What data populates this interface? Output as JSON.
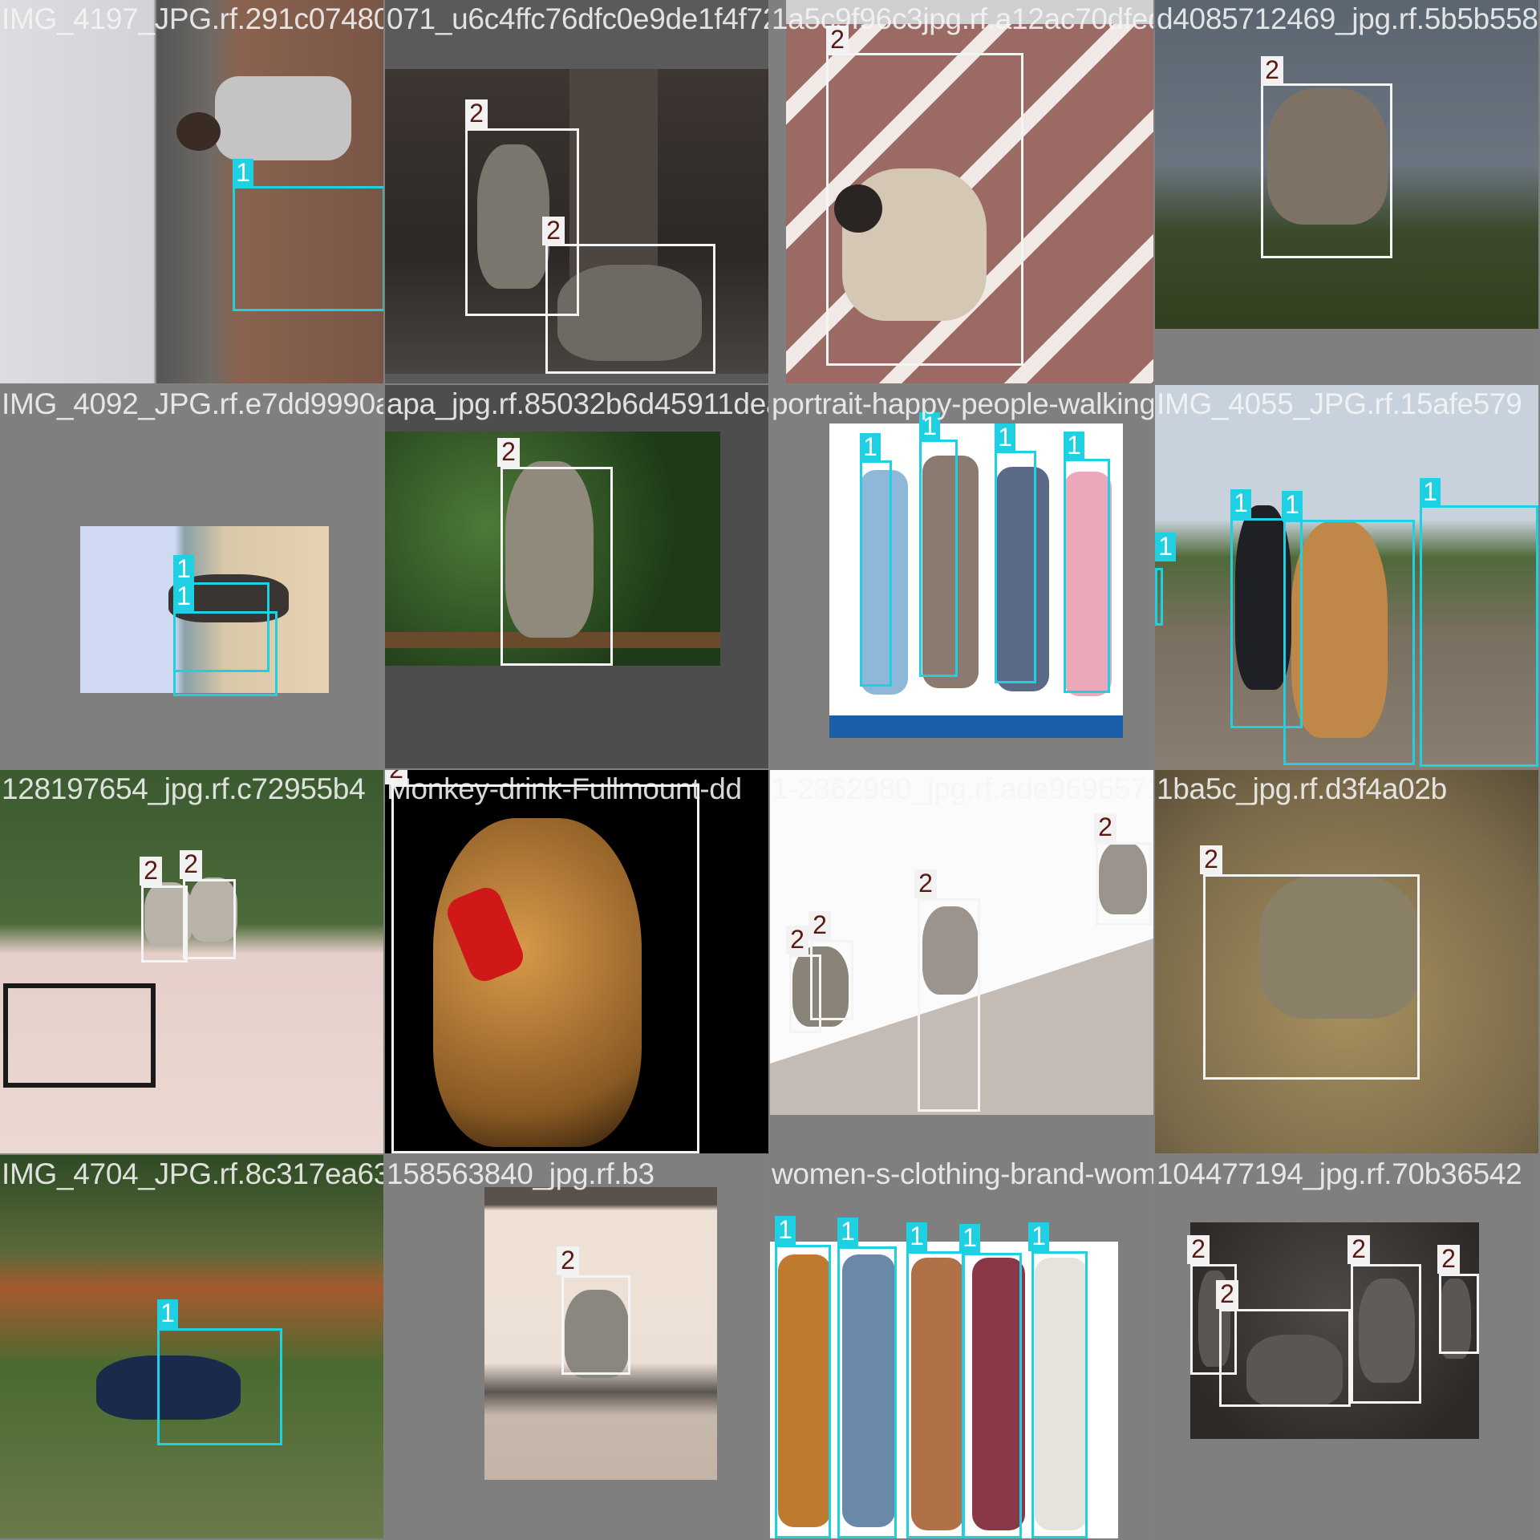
{
  "colors": {
    "class_1": "#1fd0e2",
    "class_2": "#f4f4f4",
    "label_2_text": "#5a1a12",
    "canvas": "#808080"
  },
  "tiles": [
    {
      "filename": "IMG_4197_JPG.rf.291c0748027ad6c4fc7627029"
    },
    {
      "filename": "071_u6c4ffc76dfc0e9de1f4f727582f9672_3_jpg"
    },
    {
      "filename": "1a5c9f96c3jpg.rf.a12ac70dfed0c5b74f6d9eb2dfe"
    },
    {
      "filename": "d4085712469_jpg.rf.5b5b558d"
    },
    {
      "filename": "IMG_4092_JPG.rf.e7dd9990a6399a78853627a5"
    },
    {
      "filename": "apa_jpg.rf.85032b6d45911deab07c98"
    },
    {
      "filename": "portrait-happy-people-walking"
    },
    {
      "filename": "IMG_4055_JPG.rf.15afe579"
    },
    {
      "filename": "128197654_jpg.rf.c72955b4"
    },
    {
      "filename": "Monkey-drink-Fullmount-dd"
    },
    {
      "filename": "1-2362980_jpg.rf.ade9696571424781028d8533.d87a7429"
    },
    {
      "filename": "1ba5c_jpg.rf.d3f4a02b"
    },
    {
      "filename": "IMG_4704_JPG.rf.8c317ea63585684d30f1bd37601db09f40a457521b615"
    },
    {
      "filename": "158563840_jpg.rf.b3"
    },
    {
      "filename": "women-s-clothing-brand-women-fashion_jpg"
    },
    {
      "filename": "104477194_jpg.rf.70b36542"
    }
  ],
  "boxes": [
    {
      "class": "1"
    },
    {
      "class": "2"
    },
    {
      "class": "2"
    },
    {
      "class": "2"
    },
    {
      "class": "2"
    },
    {
      "class": "1"
    },
    {
      "class": "1"
    },
    {
      "class": "2"
    },
    {
      "class": "1"
    },
    {
      "class": "1"
    },
    {
      "class": "1"
    },
    {
      "class": "1"
    },
    {
      "class": "1"
    },
    {
      "class": "1"
    },
    {
      "class": "1"
    },
    {
      "class": "1"
    },
    {
      "class": "2"
    },
    {
      "class": "2"
    },
    {
      "class": "2"
    },
    {
      "class": "2"
    },
    {
      "class": "2"
    },
    {
      "class": "2"
    },
    {
      "class": "2"
    },
    {
      "class": "2"
    },
    {
      "class": "1"
    },
    {
      "class": "2"
    },
    {
      "class": "1"
    },
    {
      "class": "1"
    },
    {
      "class": "1"
    },
    {
      "class": "1"
    },
    {
      "class": "1"
    },
    {
      "class": "2"
    },
    {
      "class": "2"
    },
    {
      "class": "2"
    },
    {
      "class": "2"
    }
  ]
}
